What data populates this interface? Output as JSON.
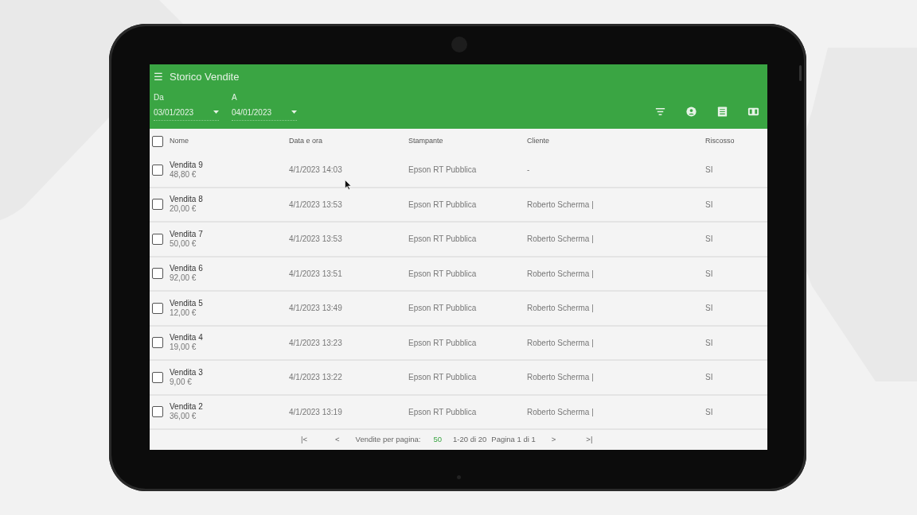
{
  "app_bar": {
    "menu_glyph": "☰",
    "title": "Storico Vendite"
  },
  "filters": [
    {
      "label": "Da",
      "value": "03/01/2023"
    },
    {
      "label": "A",
      "value": "04/01/2023"
    }
  ],
  "table": {
    "select_all": {
      "checked": false
    },
    "columns": [
      "Nome",
      "Data e ora",
      "Stampante",
      "Cliente",
      "Riscosso"
    ],
    "rows": [
      {
        "name": "Vendita 9",
        "amount": "48,80 €",
        "datetime": "4/1/2023 14:03",
        "printer": "Epson RT Pubblica",
        "client": "-",
        "collected": "SI",
        "selected": false
      },
      {
        "name": "Vendita 8",
        "amount": "20,00 €",
        "datetime": "4/1/2023 13:53",
        "printer": "Epson RT Pubblica",
        "client": "Roberto Scherma |",
        "collected": "SI",
        "selected": false
      },
      {
        "name": "Vendita 7",
        "amount": "50,00 €",
        "datetime": "4/1/2023 13:53",
        "printer": "Epson RT Pubblica",
        "client": "Roberto Scherma |",
        "collected": "SI",
        "selected": false
      },
      {
        "name": "Vendita 6",
        "amount": "92,00 €",
        "datetime": "4/1/2023 13:51",
        "printer": "Epson RT Pubblica",
        "client": "Roberto Scherma |",
        "collected": "SI",
        "selected": false
      },
      {
        "name": "Vendita 5",
        "amount": "12,00 €",
        "datetime": "4/1/2023 13:49",
        "printer": "Epson RT Pubblica",
        "client": "Roberto Scherma |",
        "collected": "SI",
        "selected": false
      },
      {
        "name": "Vendita 4",
        "amount": "19,00 €",
        "datetime": "4/1/2023 13:23",
        "printer": "Epson RT Pubblica",
        "client": "Roberto Scherma |",
        "collected": "SI",
        "selected": false
      },
      {
        "name": "Vendita 3",
        "amount": "9,00 €",
        "datetime": "4/1/2023 13:22",
        "printer": "Epson RT Pubblica",
        "client": "Roberto Scherma |",
        "collected": "SI",
        "selected": false
      },
      {
        "name": "Vendita 2",
        "amount": "36,00 €",
        "datetime": "4/1/2023 13:19",
        "printer": "Epson RT Pubblica",
        "client": "Roberto Scherma |",
        "collected": "SI",
        "selected": false
      }
    ]
  },
  "pagination": {
    "first": "|<",
    "prev": "<",
    "per_page_label": "Vendite per pagina:",
    "per_page_value": "50",
    "range": "1-20 di 20",
    "page": "Pagina 1 di 1",
    "next": ">",
    "last": ">|"
  }
}
